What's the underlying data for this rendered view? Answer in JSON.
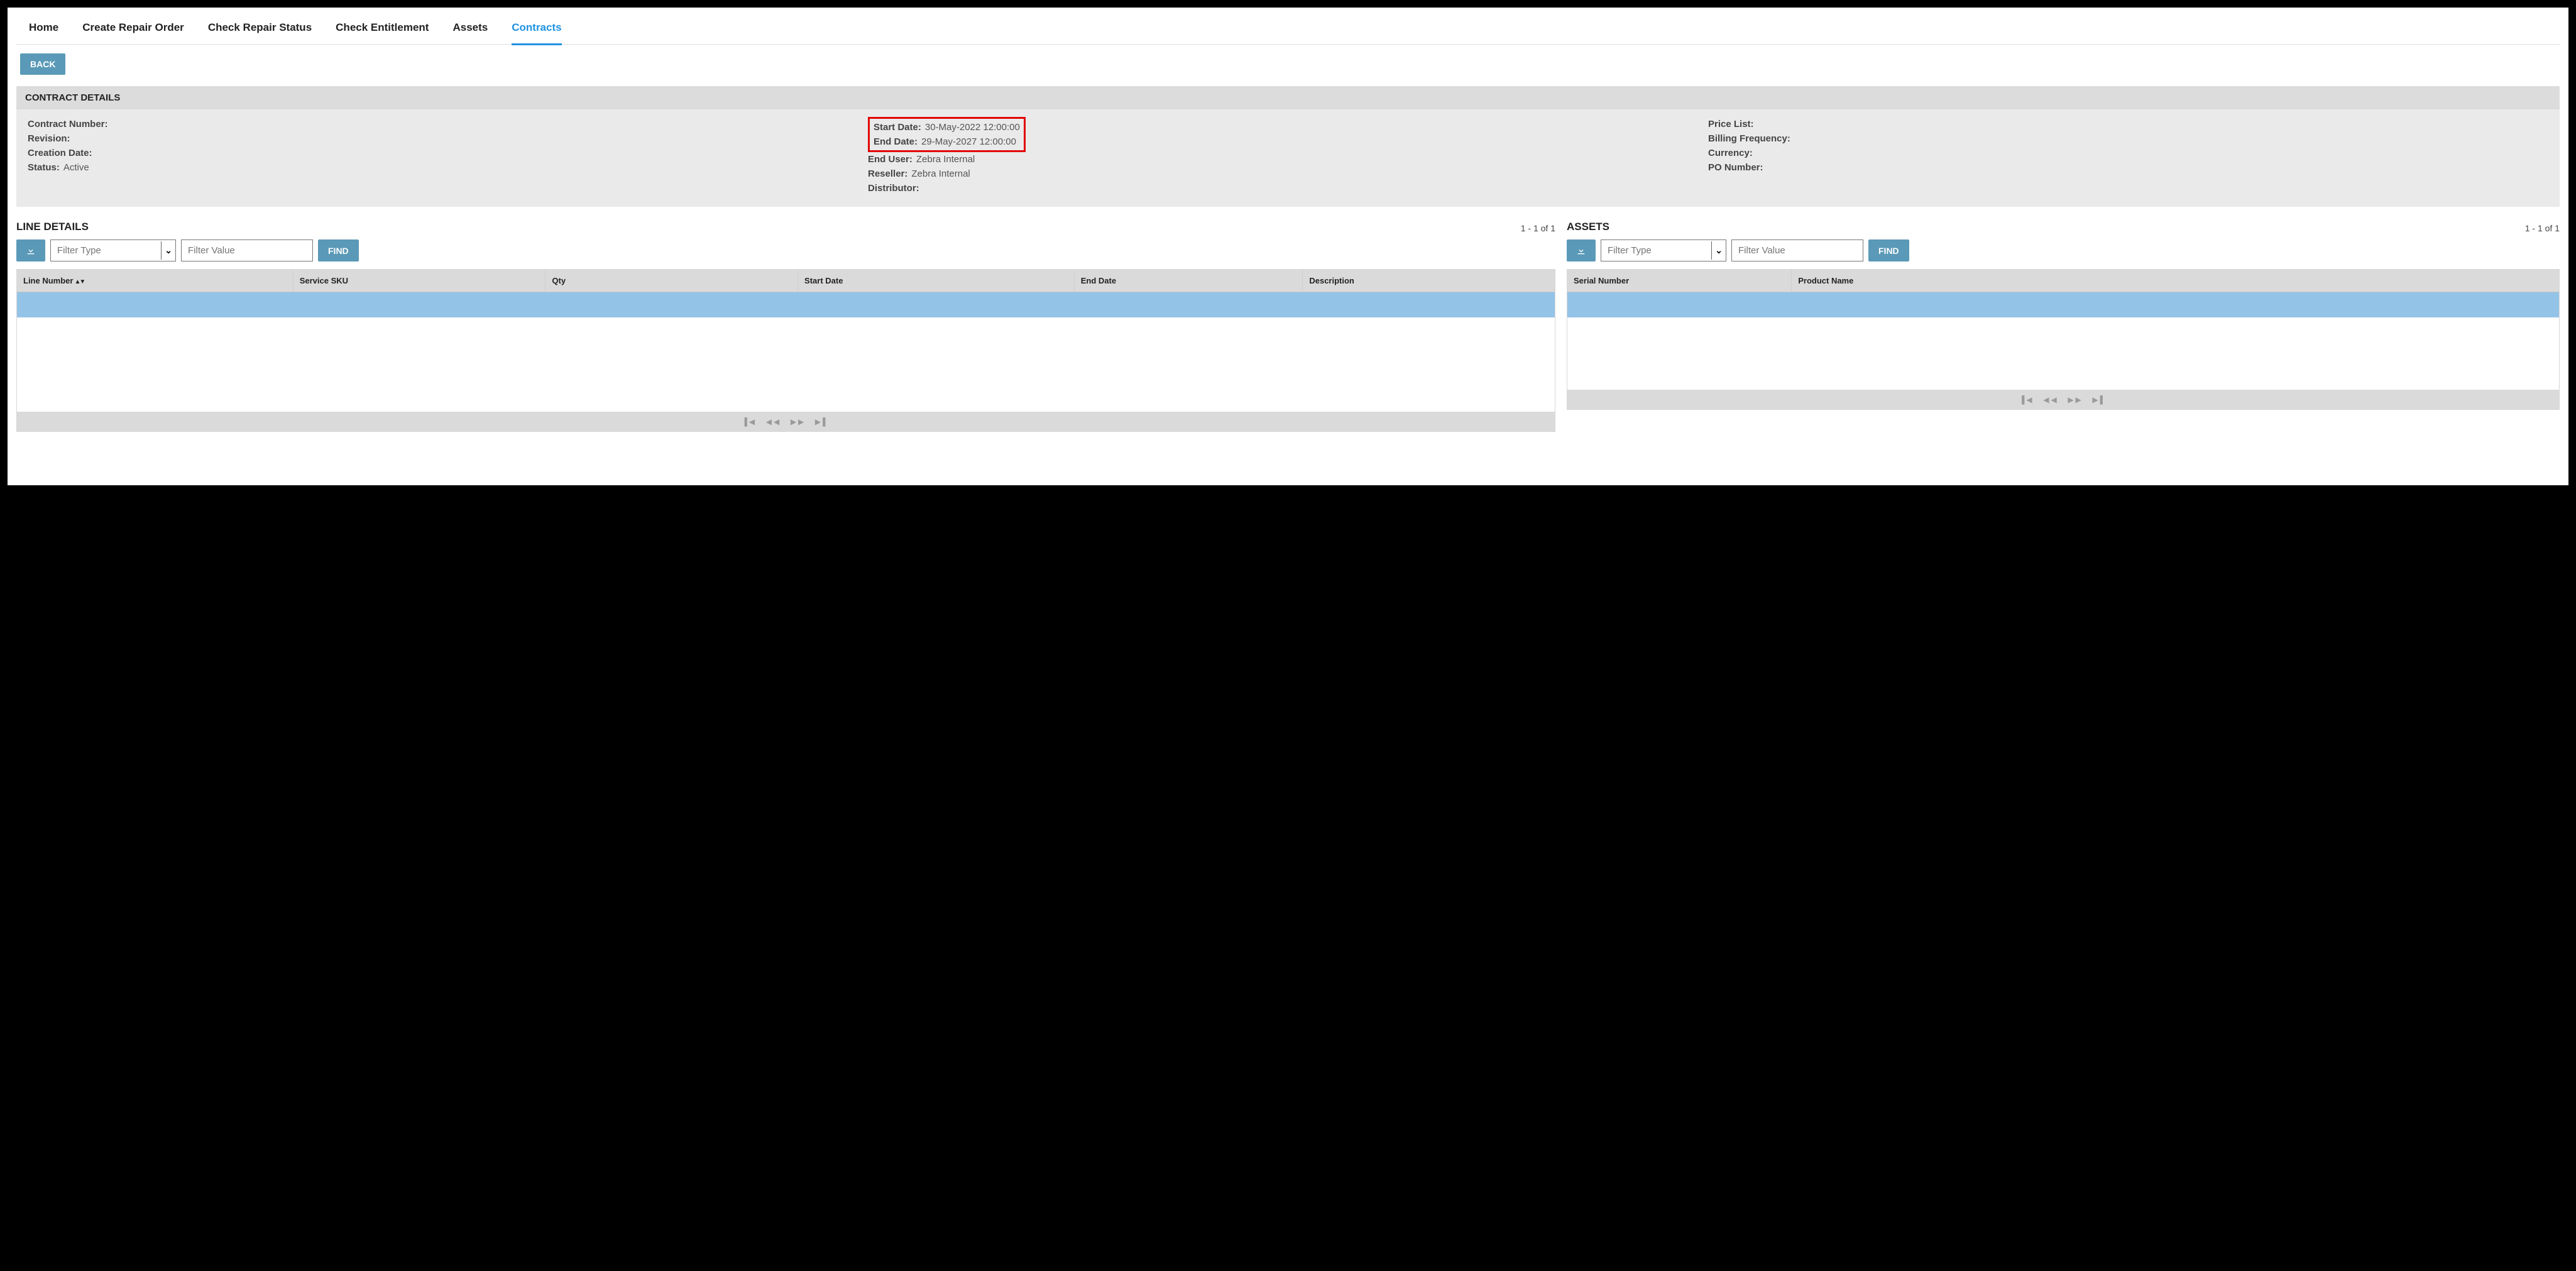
{
  "nav": {
    "tabs": [
      "Home",
      "Create Repair Order",
      "Check Repair Status",
      "Check Entitlement",
      "Assets",
      "Contracts"
    ],
    "active_index": 5
  },
  "buttons": {
    "back": "BACK",
    "find": "FIND"
  },
  "contract_panel": {
    "title": "CONTRACT DETAILS",
    "col1": {
      "contract_number_label": "Contract Number:",
      "contract_number_value": "",
      "revision_label": "Revision:",
      "revision_value": "",
      "creation_date_label": "Creation Date:",
      "creation_date_value": "",
      "status_label": "Status:",
      "status_value": "Active"
    },
    "col2": {
      "start_date_label": "Start Date:",
      "start_date_value": "30-May-2022 12:00:00",
      "end_date_label": "End Date:",
      "end_date_value": "29-May-2027 12:00:00",
      "end_user_label": "End User:",
      "end_user_value": "Zebra Internal",
      "reseller_label": "Reseller:",
      "reseller_value": "Zebra Internal",
      "distributor_label": "Distributor:",
      "distributor_value": ""
    },
    "col3": {
      "price_list_label": "Price List:",
      "price_list_value": "",
      "billing_freq_label": "Billing Frequency:",
      "billing_freq_value": "",
      "currency_label": "Currency:",
      "currency_value": "",
      "po_number_label": "PO Number:",
      "po_number_value": ""
    }
  },
  "line_details": {
    "title": "LINE DETAILS",
    "count_text": "1 - 1 of 1",
    "filter_type_placeholder": "Filter Type",
    "filter_value_placeholder": "Filter Value",
    "columns": [
      "Line Number",
      "Service SKU",
      "Qty",
      "Start Date",
      "End Date",
      "Description"
    ]
  },
  "assets": {
    "title": "ASSETS",
    "count_text": "1 - 1 of 1",
    "filter_type_placeholder": "Filter Type",
    "filter_value_placeholder": "Filter Value",
    "columns": [
      "Serial Number",
      "Product Name"
    ]
  }
}
